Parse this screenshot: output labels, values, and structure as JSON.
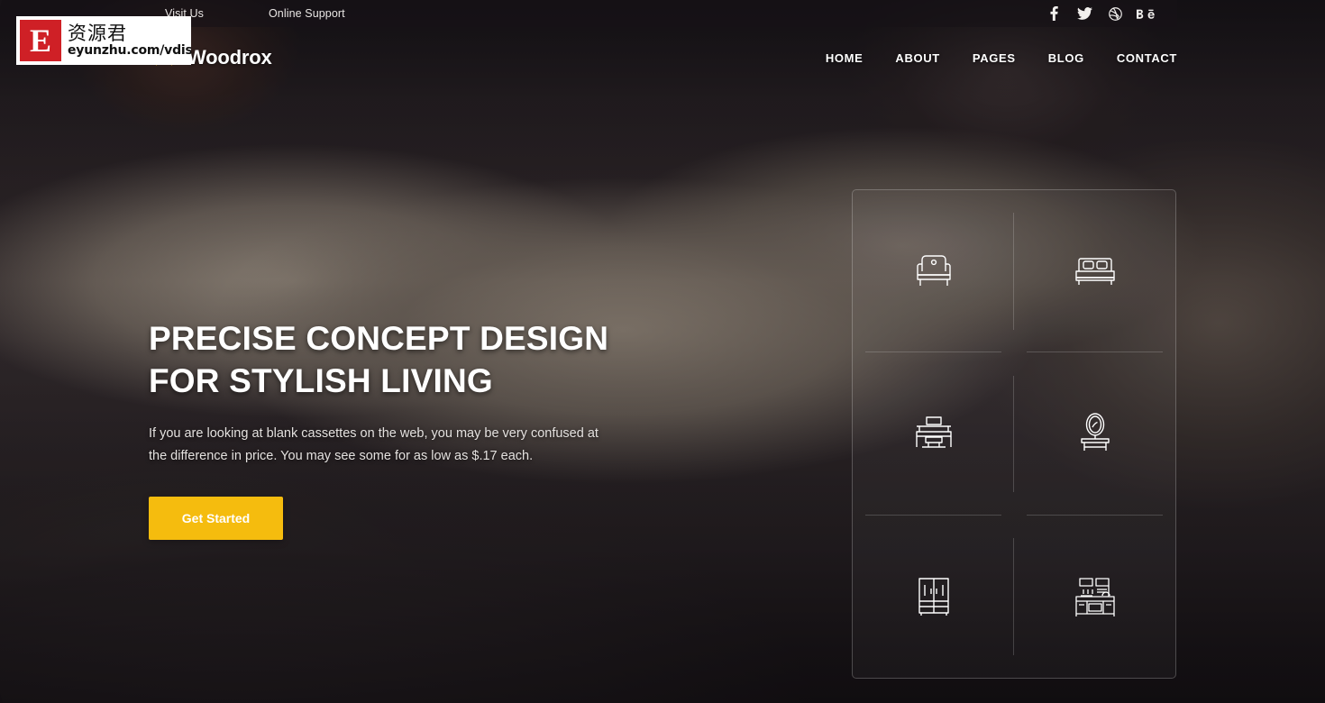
{
  "topbar": {
    "links": [
      {
        "label": "Visit Us",
        "name": "visit-us"
      },
      {
        "label": "Online Support",
        "name": "online-support"
      }
    ],
    "social": [
      {
        "name": "facebook-icon",
        "label": "Facebook"
      },
      {
        "name": "twitter-icon",
        "label": "Twitter"
      },
      {
        "name": "dribbble-icon",
        "label": "Dribbble"
      },
      {
        "name": "behance-icon",
        "label": "Behance"
      }
    ]
  },
  "header": {
    "brand_name": "Woodrox",
    "brand_mark": "crown-w-logo",
    "brand_color": "#f5bc0e",
    "nav": [
      {
        "label": "HOME"
      },
      {
        "label": "ABOUT"
      },
      {
        "label": "PAGES"
      },
      {
        "label": "BLOG"
      },
      {
        "label": "CONTACT"
      }
    ]
  },
  "hero": {
    "title": "PRECISE CONCEPT DESIGN\nFOR STYLISH LIVING",
    "subtitle": "If you are looking at blank cassettes on the web, you may be very confused at the difference in price. You may see some for as low as $.17 each.",
    "cta_label": "Get Started",
    "cta_color": "#f5bc0e"
  },
  "icon_panel": {
    "items": [
      {
        "name": "armchair-icon",
        "label": "Armchair"
      },
      {
        "name": "bed-icon",
        "label": "Bed"
      },
      {
        "name": "desk-icon",
        "label": "Desk"
      },
      {
        "name": "dressing-table-icon",
        "label": "Dressing Table"
      },
      {
        "name": "wardrobe-icon",
        "label": "Wardrobe"
      },
      {
        "name": "kitchen-cabinet-icon",
        "label": "Kitchen Cabinet"
      }
    ]
  },
  "watermark": {
    "logo_letter": "E",
    "chinese": "资源君",
    "url": "eyunzhu.com/vdisk"
  }
}
